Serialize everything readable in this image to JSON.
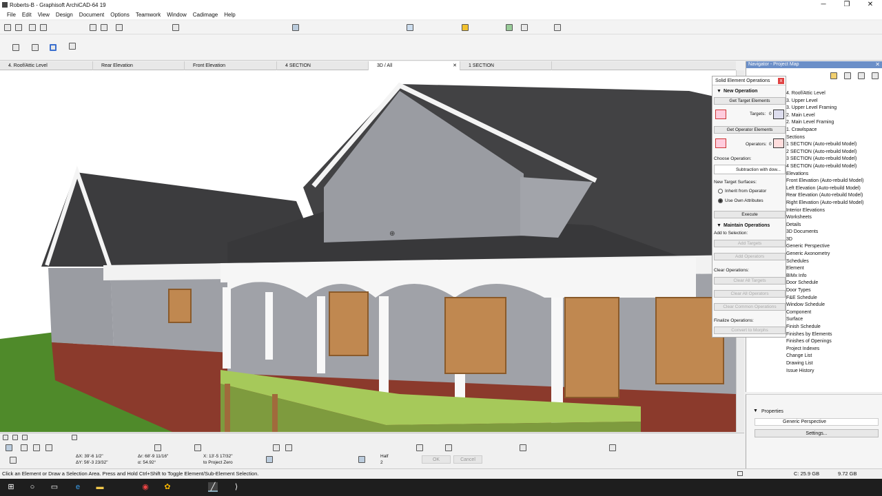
{
  "window": {
    "title": "Roberts-B - Graphisoft ArchiCAD-64 19",
    "minimize": "─",
    "restore": "❐",
    "close": "✕"
  },
  "menu": [
    "File",
    "Edit",
    "View",
    "Design",
    "Document",
    "Options",
    "Teamwork",
    "Window",
    "Cadimage",
    "Help"
  ],
  "tabs": [
    {
      "label": "4. Roof/Attic Level",
      "active": false
    },
    {
      "label": "Rear Elevation",
      "active": false
    },
    {
      "label": "Front Elevation",
      "active": false
    },
    {
      "label": "4 SECTION",
      "active": false
    },
    {
      "label": "3D / All",
      "active": true
    },
    {
      "label": "1 SECTION",
      "active": false
    }
  ],
  "tab_close": "✕",
  "navigator": {
    "title": "Navigator - Project Map",
    "tree": [
      "4. Roof/Attic Level",
      "3. Upper Level",
      "3. Upper Level Framing",
      "2. Main Level",
      "2. Main Level Framing",
      "1. Crawlspace",
      "Sections",
      "1 SECTION (Auto-rebuild Model)",
      "2 SECTION (Auto-rebuild Model)",
      "3 SECTION (Auto-rebuild Model)",
      "4 SECTION (Auto-rebuild Model)",
      "Elevations",
      "Front Elevation (Auto-rebuild Model)",
      "Left Elevation (Auto-rebuild Model)",
      "Rear Elevation (Auto-rebuild Model)",
      "Right Elevation (Auto-rebuild Model)",
      "Interior Elevations",
      "Worksheets",
      "Details",
      "3D Documents",
      "3D",
      "Generic Perspective",
      "Generic Axonometry",
      "Schedules",
      "Element",
      "BIMx Info",
      "Door Schedule",
      "Door Types",
      "F&E Schedule",
      "Window Schedule",
      "Component",
      "Surface",
      "Finish Schedule",
      "Finishes by Elements",
      "Finishes of Openings",
      "Project Indexes",
      "Change List",
      "Drawing List",
      "Issue History"
    ]
  },
  "soe": {
    "title": "Solid Element Operations",
    "close": "x",
    "new_operation": "New Operation",
    "get_targets": "Get Target Elements",
    "targets_label": "Targets:",
    "targets_count": "0",
    "get_operators": "Get Operator Elements",
    "operators_label": "Operators:",
    "operators_count": "0",
    "choose_op": "Choose Operation:",
    "operation": "Subtraction with dow...",
    "new_surfaces": "New Target Surfaces:",
    "radio_inherit": "Inherit from Operator",
    "radio_own": "Use Own Attributes",
    "execute": "Execute",
    "maintain": "Maintain Operations",
    "add_to_sel": "Add to Selection:",
    "add_targets": "Add Targets",
    "add_operators": "Add Operators",
    "clear_ops": "Clear Operations:",
    "clear_all_targets": "Clear All Targets",
    "clear_all_operators": "Clear All Operators",
    "clear_common": "Clear Common Operations",
    "finalize": "Finalize Operations:",
    "convert": "Convert to Morphs"
  },
  "properties": {
    "title": "Properties",
    "value": "Generic Perspective",
    "settings": "Settings..."
  },
  "coords": {
    "dx": "ΔX: 39'-6 1/2\"",
    "dy": "ΔY: 56'-3 23/32\"",
    "ar": "Δr: 68'-9 11/16\"",
    "a": "α: 54.92°",
    "x": "X: 13'-5 17/32\"",
    "zero": "to Project Zero",
    "half": "Half",
    "half_n": "2",
    "ok": "OK",
    "cancel": "Cancel"
  },
  "status": {
    "hint": "Click an Element or Draw a Selection Area. Press and Hold Ctrl+Shift to Toggle Element/Sub-Element Selection.",
    "c": "C: 25.9 GB",
    "mem": "9.72 GB"
  },
  "colors": {
    "nav_header": "#6b8fc8",
    "grass": "#4f8a2a",
    "brick": "#8b3a2c",
    "siding": "#9a9ca2",
    "roof": "#3c3c3e",
    "deck": "#a6c95a"
  }
}
